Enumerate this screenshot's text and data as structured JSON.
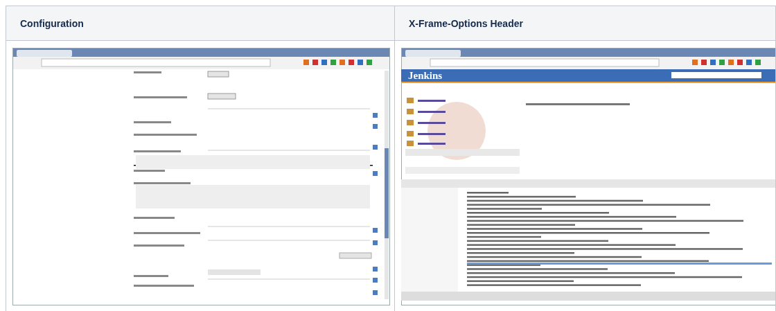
{
  "table": {
    "columns": [
      {
        "heading": "Configuration"
      },
      {
        "heading": "X-Frame-Options Header"
      }
    ],
    "cells": [
      {
        "kind": "form"
      },
      {
        "kind": "jenkins",
        "logo": "Jenkins"
      }
    ]
  }
}
